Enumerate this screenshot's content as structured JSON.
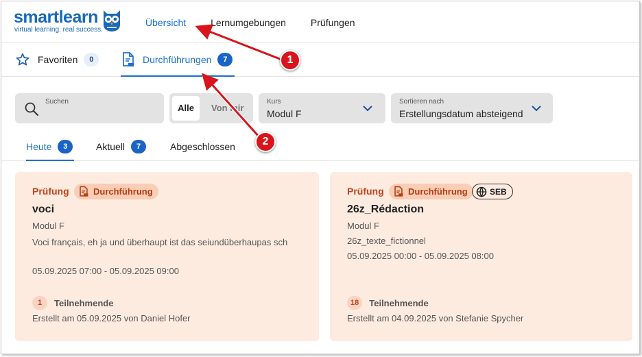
{
  "logo": {
    "word": "smartlearn",
    "tagline": "virtual learning. real success."
  },
  "main_nav": [
    "Übersicht",
    "Lernumgebungen",
    "Prüfungen"
  ],
  "subtabs": {
    "favorites": {
      "label": "Favoriten",
      "count": "0"
    },
    "executions": {
      "label": "Durchführungen",
      "count": "7"
    }
  },
  "filters": {
    "search_label": "Suchen",
    "segment": {
      "all": "Alle",
      "mine": "Von mir"
    },
    "course": {
      "label": "Kurs",
      "value": "Modul F"
    },
    "sort": {
      "label": "Sortieren nach",
      "value": "Erstellungsdatum absteigend"
    }
  },
  "list_tabs": {
    "today": {
      "label": "Heute",
      "count": "3"
    },
    "current": {
      "label": "Aktuell",
      "count": "7"
    },
    "done": {
      "label": "Abgeschlossen"
    }
  },
  "cards": [
    {
      "category": "Prüfung",
      "status": "Durchführung",
      "title": "voci",
      "course": "Modul F",
      "description": "Voci français, eh ja und überhaupt ist das seiundüberhaupas sch",
      "timeframe": "05.09.2025 07:00 - 05.09.2025 09:00",
      "participants_count": "1",
      "participants_label": "Teilnehmende",
      "created": "Erstellt am 05.09.2025 von Daniel Hofer"
    },
    {
      "category": "Prüfung",
      "status": "Durchführung",
      "seb": "SEB",
      "title": "26z_Rédaction",
      "course": "Modul F",
      "description": "26z_texte_fictionnel",
      "timeframe": "05.09.2025 00:00 - 05.09.2025 08:00",
      "participants_count": "18",
      "participants_label": "Teilnehmende",
      "created": "Erstellt am 04.09.2025 von Stefanie Spycher"
    }
  ],
  "annotations": [
    "1",
    "2"
  ],
  "colors": {
    "accent": "#1a6fd0",
    "badge": "#1b64c7",
    "card_bg": "#fdebe0",
    "status": "#c0451e",
    "marker": "#d9141a"
  }
}
